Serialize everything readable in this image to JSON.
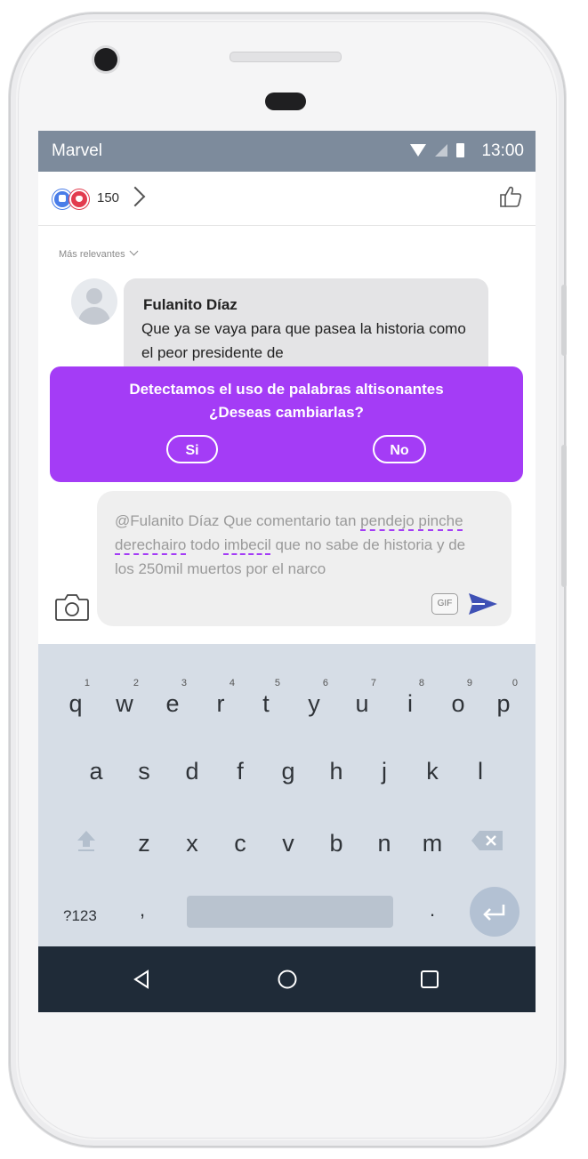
{
  "status_bar": {
    "carrier": "Marvel",
    "time": "13:00",
    "icons": [
      "wifi-icon",
      "signal-icon",
      "battery-icon"
    ]
  },
  "reactions": {
    "count": "150",
    "icons": [
      "like-reaction-icon",
      "love-reaction-icon"
    ]
  },
  "comments": {
    "sort_label": "Más relevantes",
    "items": [
      {
        "author": "Fulanito Díaz",
        "text": "Que ya  se vaya para que pasea la historia como el peor presidente de"
      }
    ]
  },
  "alert": {
    "line1": "Detectamos el uso de palabras altisonantes",
    "line2": "¿Deseas cambiarlas?",
    "yes_label": "Si",
    "no_label": "No",
    "color": "#a43cf6"
  },
  "composer": {
    "segments": [
      "@Fulanito Díaz Que comentario tan ",
      "pendejo",
      " ",
      "pinche derechairo",
      " todo ",
      "imbecil",
      " que no sabe de historia y de los 250mil muertos  por el narco"
    ],
    "gif_label": "GIF"
  },
  "keyboard": {
    "row1": [
      {
        "key": "q",
        "num": "1"
      },
      {
        "key": "w",
        "num": "2"
      },
      {
        "key": "e",
        "num": "3"
      },
      {
        "key": "r",
        "num": "4"
      },
      {
        "key": "t",
        "num": "5"
      },
      {
        "key": "y",
        "num": "6"
      },
      {
        "key": "u",
        "num": "7"
      },
      {
        "key": "i",
        "num": "8"
      },
      {
        "key": "o",
        "num": "9"
      },
      {
        "key": "p",
        "num": "0"
      }
    ],
    "row2": [
      "a",
      "s",
      "d",
      "f",
      "g",
      "h",
      "j",
      "k",
      "l"
    ],
    "row3": [
      "z",
      "x",
      "c",
      "v",
      "b",
      "n",
      "m"
    ],
    "symbols_label": "?123",
    "comma": ",",
    "period": "."
  },
  "colors": {
    "status_bar": "#7d8b9c",
    "keyboard_bg": "#d6dde6",
    "nav_bar": "#1f2b38",
    "send": "#3f51b5"
  }
}
